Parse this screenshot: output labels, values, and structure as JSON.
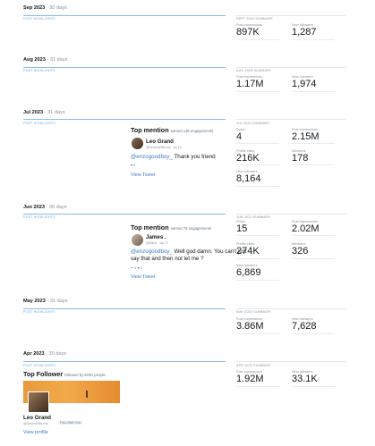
{
  "months": {
    "sep": {
      "title": "Sep 2023",
      "days": "· 30 days",
      "highlights_label": "POST HIGHLIGHTS",
      "summary_label": "SEPT 2023 SUMMARY",
      "stats": [
        {
          "label": "Post impressions",
          "value": "897K"
        },
        {
          "label": "New followers",
          "value": "1,287"
        }
      ]
    },
    "aug": {
      "title": "Aug 2023",
      "days": "· 31 days",
      "highlights_label": "POST HIGHLIGHTS",
      "summary_label": "AUG 2023 SUMMARY",
      "stats": [
        {
          "label": "Post impressions",
          "value": "1.17M"
        },
        {
          "label": "New followers",
          "value": "1,974"
        }
      ]
    },
    "jul": {
      "title": "Jul 2023",
      "days": "· 31 days",
      "highlights_label": "POST HIGHLIGHTS",
      "summary_label": "JUL 2023 SUMMARY",
      "stats": [
        {
          "label": "Posts",
          "value": "4"
        },
        {
          "label": "Post impressions",
          "value": "2.15M"
        },
        {
          "label": "Profile visits",
          "value": "216K"
        },
        {
          "label": "Mentions",
          "value": "178"
        },
        {
          "label": "New followers",
          "value": "8,164"
        }
      ],
      "mention": {
        "title": "Top mention",
        "subtitle": "earned 135 engagements",
        "name": "Leo Grand",
        "handle": "@GenzoWhitLeos · Jul 10",
        "handle_text": "@enzogoodboy_",
        "text": "  Thank you friend",
        "icons": "♥ 9",
        "link": "View Tweet"
      }
    },
    "jun": {
      "title": "Jun 2023",
      "days": "· 30 days",
      "highlights_label": "POST HIGHLIGHTS",
      "summary_label": "JUN 2023 SUMMARY",
      "stats": [
        {
          "label": "Posts",
          "value": "15"
        },
        {
          "label": "Post impressions",
          "value": "2.02M"
        },
        {
          "label": "Profile visits",
          "value": "274K"
        },
        {
          "label": "Mentions",
          "value": "326"
        },
        {
          "label": "New followers",
          "value": "6,869"
        }
      ],
      "mention": {
        "title": "Top mention",
        "subtitle": "earned 76 engagements",
        "name": "James .",
        "handle": "@Mdkrt · Jun 17",
        "handle_text": "@enzogoodboy_",
        "text": " Well god damn. You can't just say that and then not let me ?",
        "icons": "↩ 1   ♥ 2",
        "link": "View Tweet"
      }
    },
    "may": {
      "title": "May 2023",
      "days": "· 31 days",
      "highlights_label": "POST HIGHLIGHTS",
      "summary_label": "MAY 2023 SUMMARY",
      "stats": [
        {
          "label": "Post impressions",
          "value": "3.86M"
        },
        {
          "label": "New followers",
          "value": "7,628"
        }
      ]
    },
    "apr": {
      "title": "Apr 2023",
      "days": "· 30 days",
      "highlights_label": "POST HIGHLIGHTS",
      "summary_label": "APR 2023 SUMMARY",
      "stats": [
        {
          "label": "Post impressions",
          "value": "1.92M"
        },
        {
          "label": "New followers",
          "value": "33.1K"
        }
      ],
      "top_follower": {
        "title": "Top Follower",
        "subtitle": "followed by 604K people",
        "name": "Leo Grand",
        "handle": "@GenzoWhitLeos",
        "badge": "FOLLOWS YOU",
        "link": "View profile"
      }
    }
  }
}
